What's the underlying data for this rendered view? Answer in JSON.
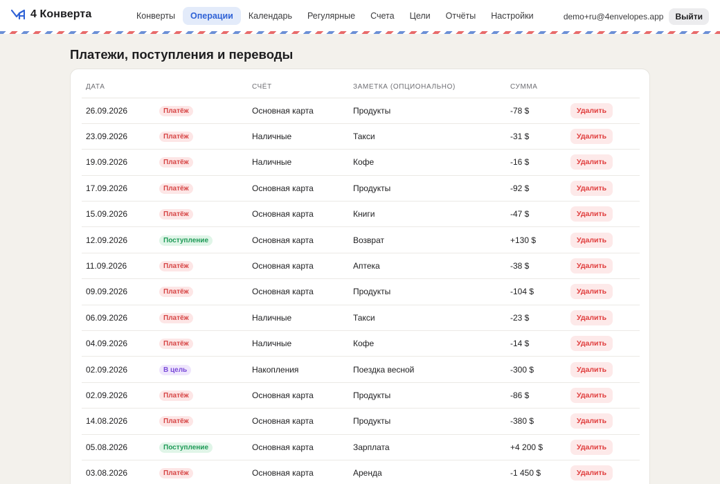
{
  "app": {
    "logo_text": "4 Конверта",
    "brand_color": "#2f62d6"
  },
  "nav": {
    "items": [
      {
        "label": "Конверты",
        "active": false
      },
      {
        "label": "Операции",
        "active": true
      },
      {
        "label": "Календарь",
        "active": false
      },
      {
        "label": "Регулярные",
        "active": false
      },
      {
        "label": "Счета",
        "active": false
      },
      {
        "label": "Цели",
        "active": false
      },
      {
        "label": "Отчёты",
        "active": false
      },
      {
        "label": "Настройки",
        "active": false
      }
    ]
  },
  "user": {
    "email": "demo+ru@4envelopes.app",
    "logout_label": "Выйти"
  },
  "page": {
    "title": "Платежи, поступления и переводы"
  },
  "table": {
    "headers": {
      "date": "ДАТА",
      "type": "",
      "account": "СЧЁТ",
      "note": "ЗАМЕТКА (ОПЦИОНАЛЬНО)",
      "amount": "СУММА"
    },
    "delete_label": "Удалить",
    "rows": [
      {
        "date": "26.09.2026",
        "type": "Платёж",
        "kind": "payment",
        "account": "Основная карта",
        "note": "Продукты",
        "amount": "-78 $"
      },
      {
        "date": "23.09.2026",
        "type": "Платёж",
        "kind": "payment",
        "account": "Наличные",
        "note": "Такси",
        "amount": "-31 $"
      },
      {
        "date": "19.09.2026",
        "type": "Платёж",
        "kind": "payment",
        "account": "Наличные",
        "note": "Кофе",
        "amount": "-16 $"
      },
      {
        "date": "17.09.2026",
        "type": "Платёж",
        "kind": "payment",
        "account": "Основная карта",
        "note": "Продукты",
        "amount": "-92 $"
      },
      {
        "date": "15.09.2026",
        "type": "Платёж",
        "kind": "payment",
        "account": "Основная карта",
        "note": "Книги",
        "amount": "-47 $"
      },
      {
        "date": "12.09.2026",
        "type": "Поступление",
        "kind": "income",
        "account": "Основная карта",
        "note": "Возврат",
        "amount": "+130 $"
      },
      {
        "date": "11.09.2026",
        "type": "Платёж",
        "kind": "payment",
        "account": "Основная карта",
        "note": "Аптека",
        "amount": "-38 $"
      },
      {
        "date": "09.09.2026",
        "type": "Платёж",
        "kind": "payment",
        "account": "Основная карта",
        "note": "Продукты",
        "amount": "-104 $"
      },
      {
        "date": "06.09.2026",
        "type": "Платёж",
        "kind": "payment",
        "account": "Наличные",
        "note": "Такси",
        "amount": "-23 $"
      },
      {
        "date": "04.09.2026",
        "type": "Платёж",
        "kind": "payment",
        "account": "Наличные",
        "note": "Кофе",
        "amount": "-14 $"
      },
      {
        "date": "02.09.2026",
        "type": "В цель",
        "kind": "goal",
        "account": "Накопления",
        "note": "Поездка весной",
        "amount": "-300 $"
      },
      {
        "date": "02.09.2026",
        "type": "Платёж",
        "kind": "payment",
        "account": "Основная карта",
        "note": "Продукты",
        "amount": "-86 $"
      },
      {
        "date": "14.08.2026",
        "type": "Платёж",
        "kind": "payment",
        "account": "Основная карта",
        "note": "Продукты",
        "amount": "-380 $"
      },
      {
        "date": "05.08.2026",
        "type": "Поступление",
        "kind": "income",
        "account": "Основная карта",
        "note": "Зарплата",
        "amount": "+4 200 $"
      },
      {
        "date": "03.08.2026",
        "type": "Платёж",
        "kind": "payment",
        "account": "Основная карта",
        "note": "Аренда",
        "amount": "-1 450 $"
      }
    ]
  }
}
